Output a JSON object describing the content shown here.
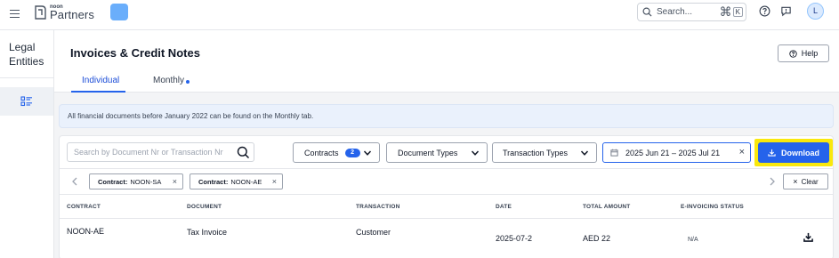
{
  "topbar": {
    "brand_small": "noon",
    "brand_big": "Partners",
    "search_placeholder": "Search...",
    "shortcut_cmd": "⌘",
    "shortcut_key": "K",
    "avatar_initial": "L"
  },
  "sidebar": {
    "title_line1": "Legal",
    "title_line2": "Entities"
  },
  "header": {
    "title": "Invoices & Credit Notes",
    "help_label": "Help",
    "tabs": [
      {
        "label": "Individual",
        "active": true
      },
      {
        "label": "Monthly",
        "active": false
      }
    ]
  },
  "banner": {
    "text": "All financial documents before January 2022 can be found on the Monthly tab."
  },
  "filters": {
    "search_placeholder": "Search by Document Nr or Transaction Nr",
    "contracts_label": "Contracts",
    "contracts_count": "2",
    "document_types_label": "Document Types",
    "transaction_types_label": "Transaction Types",
    "date_range": "2025 Jun 21 – 2025 Jul 21",
    "download_label": "Download",
    "chips": [
      {
        "key": "Contract:",
        "value": "NOON-SA"
      },
      {
        "key": "Contract:",
        "value": "NOON-AE"
      }
    ],
    "clear_label": "Clear"
  },
  "table": {
    "columns": [
      "CONTRACT",
      "DOCUMENT",
      "TRANSACTION",
      "DATE",
      "TOTAL AMOUNT",
      "E-INVOICING STATUS"
    ],
    "rows": [
      {
        "contract": "NOON-AE",
        "document": "Tax Invoice",
        "transaction": "Customer",
        "date": "2025-07-2",
        "total_amount": "AED 22",
        "einvoicing_status": "N/A"
      }
    ]
  },
  "colors": {
    "accent": "#2563eb",
    "highlight": "#f9e80c",
    "banner_bg": "#eaf1fc"
  }
}
